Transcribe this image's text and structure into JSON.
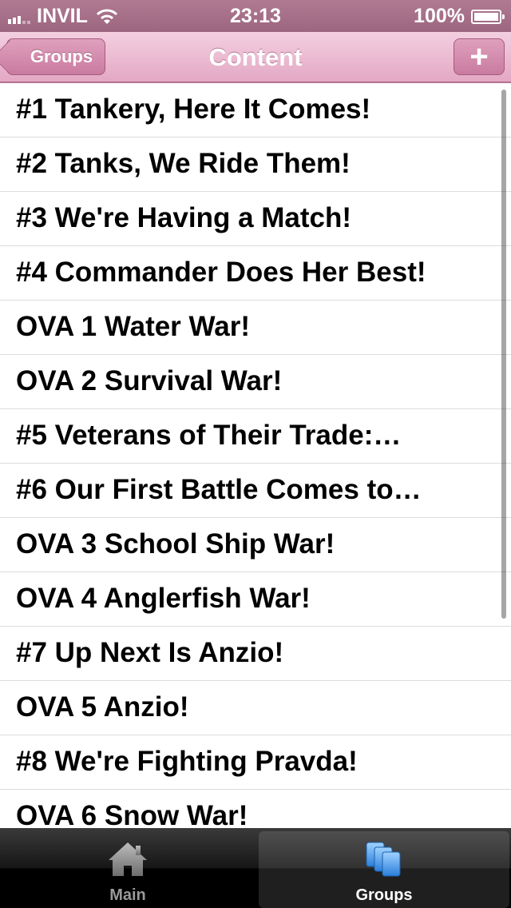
{
  "status_bar": {
    "carrier": "INVIL",
    "time": "23:13",
    "battery": "100%"
  },
  "nav": {
    "title": "Content",
    "back_label": "Groups",
    "add_label": "+"
  },
  "list": {
    "items": [
      "#1 Tankery, Here It Comes!",
      "#2 Tanks, We Ride Them!",
      "#3 We're Having a Match!",
      "#4 Commander Does Her Best!",
      "OVA 1 Water War!",
      "OVA 2 Survival War!",
      "#5 Veterans of Their Trade:…",
      "#6 Our First Battle Comes to…",
      "OVA 3 School Ship War!",
      "OVA 4 Anglerfish War!",
      "#7 Up Next Is Anzio!",
      "OVA 5 Anzio!",
      "#8 We're Fighting Pravda!",
      "OVA 6 Snow War!"
    ]
  },
  "tab_bar": {
    "tabs": [
      {
        "label": "Main",
        "icon": "house-icon",
        "selected": false
      },
      {
        "label": "Groups",
        "icon": "groups-stack-icon",
        "selected": true
      }
    ]
  },
  "colors": {
    "nav_pink": "#e3a8c4",
    "status_mauve": "#a46f88",
    "tab_selected_icon": "#3d8fe0"
  }
}
